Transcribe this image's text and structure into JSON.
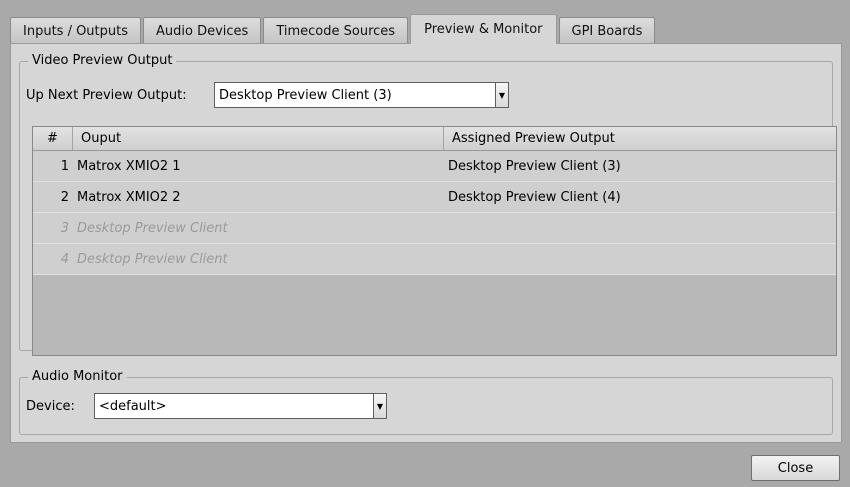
{
  "tabs": [
    {
      "label": "Inputs / Outputs"
    },
    {
      "label": "Audio Devices"
    },
    {
      "label": "Timecode Sources"
    },
    {
      "label": "Preview & Monitor"
    },
    {
      "label": "GPI Boards"
    }
  ],
  "active_tab": "Preview & Monitor",
  "video_preview": {
    "group_title": "Video Preview Output",
    "up_next_label": "Up Next Preview Output:",
    "up_next_value": "Desktop Preview Client (3)",
    "columns": [
      "#",
      "Ouput",
      "Assigned Preview Output"
    ],
    "rows": [
      {
        "num": "1",
        "output": "Matrox XMIO2 1",
        "assigned": "Desktop Preview Client (3)",
        "disabled": false
      },
      {
        "num": "2",
        "output": "Matrox XMIO2 2",
        "assigned": "Desktop Preview Client (4)",
        "disabled": false
      },
      {
        "num": "3",
        "output": "Desktop Preview Client",
        "assigned": "",
        "disabled": true
      },
      {
        "num": "4",
        "output": "Desktop Preview Client",
        "assigned": "",
        "disabled": true
      }
    ]
  },
  "audio_monitor": {
    "group_title": "Audio Monitor",
    "device_label": "Device:",
    "device_value": "<default>"
  },
  "footer": {
    "close_label": "Close"
  },
  "colors": {
    "panel_bg": "#d6d6d6",
    "window_bg": "#a9a9a9",
    "row_bg": "#cfcfcf",
    "disabled_text": "#9a9a9a"
  }
}
